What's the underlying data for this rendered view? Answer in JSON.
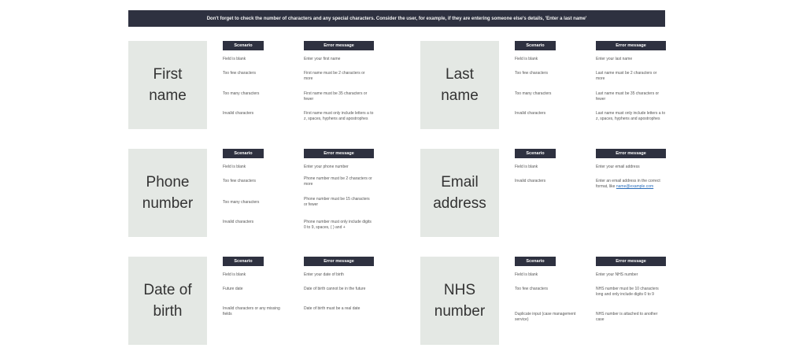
{
  "banner": "Don't forget to check the number of characters and any special characters. Consider the user, for example, if they are entering someone else's details, 'Enter a last name'",
  "headers": {
    "scenario": "Scenario",
    "error": "Error message"
  },
  "cards": [
    {
      "label": "First\nname",
      "rows": [
        {
          "scenario": "Field is blank",
          "error": "Enter your first name"
        },
        {
          "scenario": "Too few characters",
          "error": "First name must be 2 characters or more"
        },
        {
          "scenario": "Too many characters",
          "error": "First name must be 35 characters or fewer"
        },
        {
          "scenario": "Invalid characters",
          "error": "First name must only include letters a to z, spaces, hyphens and apostrophes"
        }
      ]
    },
    {
      "label": "Last\nname",
      "rows": [
        {
          "scenario": "Field is blank",
          "error": "Enter your last name"
        },
        {
          "scenario": "Too few characters",
          "error": "Last name must be 2 characters or more"
        },
        {
          "scenario": "Too many characters",
          "error": "Last name must be 35 characters or fewer"
        },
        {
          "scenario": "Invalid characters",
          "error": "Last name must only include letters a to z, spaces, hyphens and apostrophes"
        }
      ]
    },
    {
      "label": "Phone\nnumber",
      "rows": [
        {
          "scenario": "Field is blank",
          "error": "Enter your phone number"
        },
        {
          "scenario": "Too few characters",
          "error": "Phone number must be 2 characters or more"
        },
        {
          "scenario": "Too many characters",
          "error": "Phone number must be 15 characters or fewer"
        },
        {
          "scenario": "Invalid characters",
          "error": "Phone number must only include digits 0 to 9, spaces, ( ) and +"
        }
      ]
    },
    {
      "label": "Email\naddress",
      "rows": [
        {
          "scenario": "Field is blank",
          "error": "Enter your email address"
        },
        {
          "scenario": "Invalid characters",
          "error": "Enter an email address in the correct format, like ",
          "link": "name@example.com"
        }
      ]
    },
    {
      "label": "Date of\nbirth",
      "rows": [
        {
          "scenario": "Field is blank",
          "error": "Enter your date of birth"
        },
        {
          "scenario": "Future date",
          "error": "Date of birth cannot be in the future"
        },
        {
          "scenario": "Invalid characters or any missing fields",
          "error": "Date of birth must be a real date"
        }
      ]
    },
    {
      "label": "NHS\nnumber",
      "rows": [
        {
          "scenario": "Field is blank",
          "error": "Enter your NHS number"
        },
        {
          "scenario": "Too few characters",
          "error": "NHS number must be 10 characters long and only include digits 0 to 9"
        },
        {
          "scenario": "Duplicate input (case management service)",
          "error": "NHS number is attached to another case"
        }
      ]
    }
  ]
}
